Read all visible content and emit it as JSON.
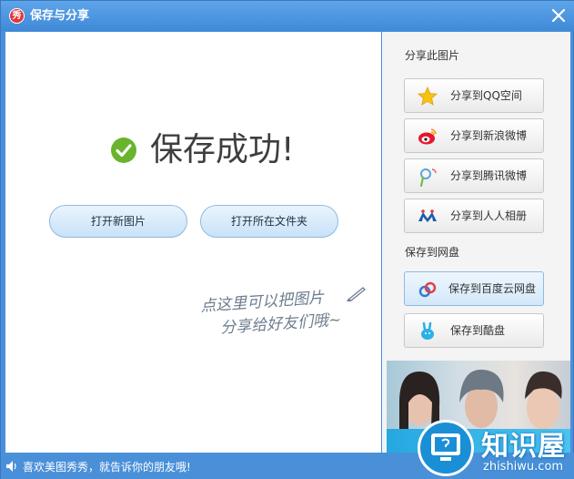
{
  "window": {
    "title": "保存与分享",
    "logo_text": "秀"
  },
  "main": {
    "success_text": "保存成功!",
    "open_new_label": "打开新图片",
    "open_folder_label": "打开所在文件夹",
    "hint_line1": "点这里可以把图片",
    "hint_line2": "分享给好友们哦~"
  },
  "side": {
    "share_title": "分享此图片",
    "share_buttons": [
      {
        "label": "分享到QQ空间",
        "icon": "qzone-star-icon"
      },
      {
        "label": "分享到新浪微博",
        "icon": "weibo-icon"
      },
      {
        "label": "分享到腾讯微博",
        "icon": "tencent-weibo-icon"
      },
      {
        "label": "分享到人人相册",
        "icon": "renren-icon"
      }
    ],
    "save_title": "保存到网盘",
    "save_buttons": [
      {
        "label": "保存到百度云网盘",
        "icon": "baidu-cloud-icon"
      },
      {
        "label": "保存到酷盘",
        "icon": "kupan-rabbit-icon"
      }
    ]
  },
  "status": {
    "text": "喜欢美图秀秀，就告诉你的朋友哦!"
  },
  "watermark": {
    "text": "知识屋",
    "url": "zhishiwu.com"
  },
  "colors": {
    "titlebar": "#4a90d9",
    "success_green": "#6ab42d",
    "button_blue": "#c9e2f8"
  }
}
